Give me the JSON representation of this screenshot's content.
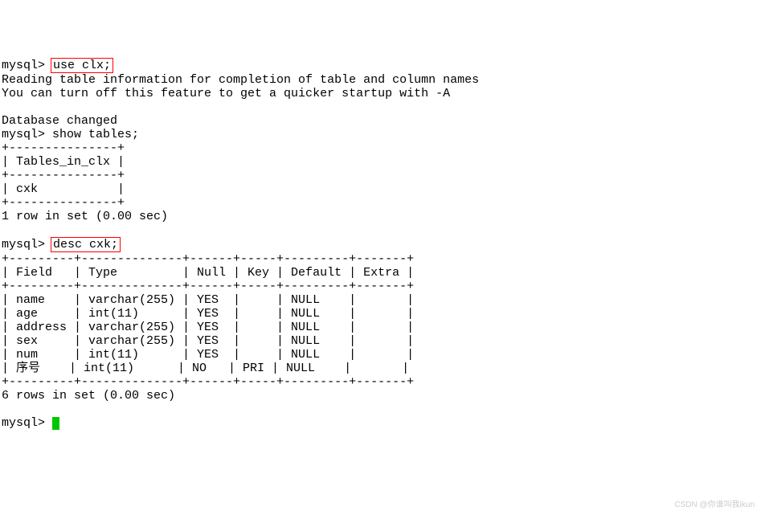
{
  "prompt": "mysql> ",
  "cmd1": "use clx;",
  "msg1": "Reading table information for completion of table and column names",
  "msg2": "You can turn off this feature to get a quicker startup with -A",
  "msg3": "Database changed",
  "cmd2": "show tables;",
  "tables_border": "+---------------+",
  "tables_header": "| Tables_in_clx |",
  "tables_row1": "| cxk           |",
  "tables_summary": "1 row in set (0.00 sec)",
  "cmd3": "desc cxk;",
  "desc_border": "+---------+--------------+------+-----+---------+-------+",
  "desc_header": "| Field   | Type         | Null | Key | Default | Extra |",
  "desc_r1": "| name    | varchar(255) | YES  |     | NULL    |       |",
  "desc_r2": "| age     | int(11)      | YES  |     | NULL    |       |",
  "desc_r3": "| address | varchar(255) | YES  |     | NULL    |       |",
  "desc_r4": "| sex     | varchar(255) | YES  |     | NULL    |       |",
  "desc_r5": "| num     | int(11)      | YES  |     | NULL    |       |",
  "desc_r6": "| 序号    | int(11)      | NO   | PRI | NULL    |       |",
  "desc_summary": "6 rows in set (0.00 sec)",
  "watermark": "CSDN @你谁叫我ikun",
  "chart_data": {
    "type": "table",
    "title": "desc cxk",
    "columns": [
      "Field",
      "Type",
      "Null",
      "Key",
      "Default",
      "Extra"
    ],
    "rows": [
      [
        "name",
        "varchar(255)",
        "YES",
        "",
        "NULL",
        ""
      ],
      [
        "age",
        "int(11)",
        "YES",
        "",
        "NULL",
        ""
      ],
      [
        "address",
        "varchar(255)",
        "YES",
        "",
        "NULL",
        ""
      ],
      [
        "sex",
        "varchar(255)",
        "YES",
        "",
        "NULL",
        ""
      ],
      [
        "num",
        "int(11)",
        "YES",
        "",
        "NULL",
        ""
      ],
      [
        "序号",
        "int(11)",
        "NO",
        "PRI",
        "NULL",
        ""
      ]
    ]
  }
}
